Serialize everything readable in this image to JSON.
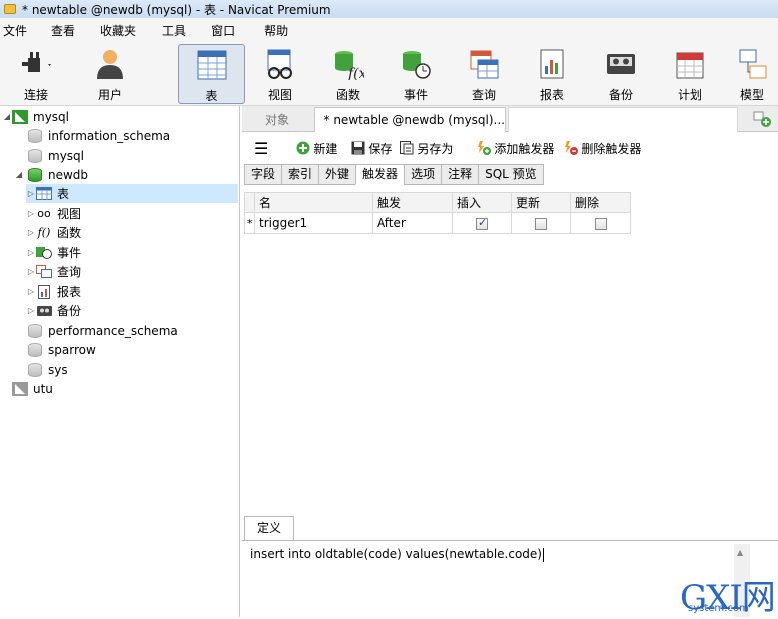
{
  "window": {
    "title": "* newtable @newdb (mysql) - 表 - Navicat Premium"
  },
  "menu": [
    "文件",
    "查看",
    "收藏夹",
    "工具",
    "窗口",
    "帮助"
  ],
  "toolbar": [
    {
      "label": "连接",
      "icon": "plug-icon"
    },
    {
      "label": "用户",
      "icon": "user-icon"
    },
    {
      "label": "表",
      "icon": "table-icon",
      "active": true
    },
    {
      "label": "视图",
      "icon": "view-icon"
    },
    {
      "label": "函数",
      "icon": "function-icon"
    },
    {
      "label": "事件",
      "icon": "event-icon"
    },
    {
      "label": "查询",
      "icon": "query-icon"
    },
    {
      "label": "报表",
      "icon": "report-icon"
    },
    {
      "label": "备份",
      "icon": "backup-icon"
    },
    {
      "label": "计划",
      "icon": "schedule-icon"
    },
    {
      "label": "模型",
      "icon": "model-icon"
    }
  ],
  "sidebar": {
    "connection": "mysql",
    "databases": [
      {
        "name": "information_schema"
      },
      {
        "name": "mysql"
      },
      {
        "name": "newdb"
      },
      {
        "name": "performance_schema"
      },
      {
        "name": "sparrow"
      },
      {
        "name": "sys"
      }
    ],
    "newdb_children": [
      "表",
      "视图",
      "函数",
      "事件",
      "查询",
      "报表",
      "备份"
    ],
    "second_connection": "utu"
  },
  "tabs": {
    "objects": "对象",
    "document": "* newtable @newdb (mysql)..."
  },
  "subtoolbar": {
    "new": "新建",
    "save": "保存",
    "save_as": "另存为",
    "add_trigger": "添加触发器",
    "delete_trigger": "删除触发器"
  },
  "property_tabs": [
    "字段",
    "索引",
    "外键",
    "触发器",
    "选项",
    "注释",
    "SQL 预览"
  ],
  "trigger_grid": {
    "headers": [
      "名",
      "触发",
      "插入",
      "更新",
      "删除"
    ],
    "rows": [
      {
        "marker": "*",
        "name": "trigger1",
        "timing": "After",
        "insert": true,
        "update": false,
        "delete": false
      }
    ]
  },
  "definition": {
    "tab_label": "定义",
    "code": "insert into oldtable(code) values(newtable.code)"
  },
  "watermark": {
    "big": "GXI网",
    "small": "system.com"
  }
}
